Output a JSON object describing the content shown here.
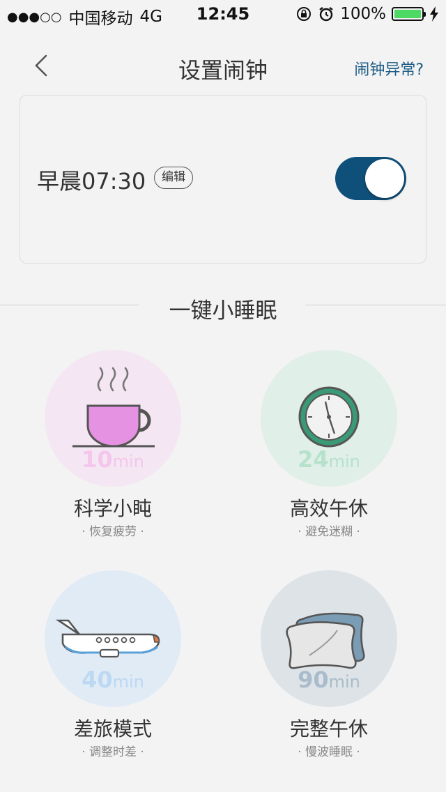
{
  "status_bar": {
    "signal": "●●●○○",
    "carrier": "中国移动",
    "network": "4G",
    "time": "12:45",
    "battery_text": "100%",
    "battery_level": 1.0
  },
  "nav": {
    "title": "设置闹钟",
    "help_link": "闹钟异常?"
  },
  "alarm": {
    "label": "早晨07:30",
    "edit_label": "编辑",
    "enabled": true
  },
  "section": {
    "title": "一键小睡眠"
  },
  "naps": [
    {
      "minutes": "10",
      "unit": "min",
      "name": "科学小盹",
      "subtitle": "· 恢复疲劳 ·",
      "icon": "coffee-cup-icon"
    },
    {
      "minutes": "24",
      "unit": "min",
      "name": "高效午休",
      "subtitle": "· 避免迷糊 ·",
      "icon": "clock-icon"
    },
    {
      "minutes": "40",
      "unit": "min",
      "name": "差旅模式",
      "subtitle": "· 调整时差 ·",
      "icon": "airplane-icon"
    },
    {
      "minutes": "90",
      "unit": "min",
      "name": "完整午休",
      "subtitle": "· 慢波睡眠 ·",
      "icon": "pillow-icon"
    }
  ],
  "colors": {
    "accent": "#0f507a",
    "help_link": "#1c5b85",
    "nap1_bg": "#f4e6f2",
    "nap2_bg": "#e0efe8",
    "nap3_bg": "#e0ebf6",
    "nap4_bg": "#dde3e7"
  }
}
